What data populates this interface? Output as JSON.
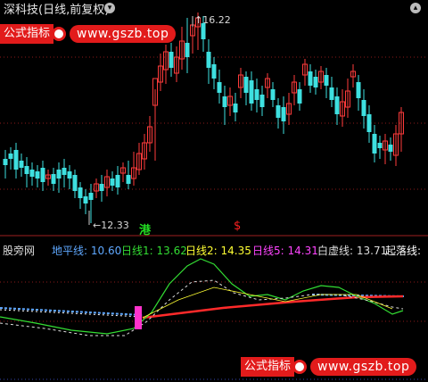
{
  "header": {
    "title": "深科技(日线,前复权)",
    "menu_icon": "chevron-down-icon",
    "corner_icon": "chevron-up-icon"
  },
  "watermark_top": {
    "label": "公式指标",
    "url": "www.gszb.top"
  },
  "watermark_bottom": {
    "label": "公式指标",
    "url": "www.gszb.top"
  },
  "price_marks": {
    "high": "16.22",
    "low": "12.33"
  },
  "signals": {
    "gang": "港",
    "s": "$"
  },
  "indicator": {
    "name": "股旁网",
    "items": [
      {
        "label": "地平线: 10.60",
        "color": "#5fa8ff"
      },
      {
        "label": "日线1: 13.62",
        "color": "#33dd33"
      },
      {
        "label": "日线2: 14.35",
        "color": "#ffff33"
      },
      {
        "label": "日线5: 14.31",
        "color": "#ff44ff"
      },
      {
        "label": "白虚线: 13.71",
        "color": "#dddddd"
      },
      {
        "label": "起落线:",
        "color": "#ffffff"
      }
    ]
  },
  "colors": {
    "up": "#ff3b3b",
    "down": "#3ee0e0",
    "grid": "#8b1a1a",
    "bg": "#000000"
  }
}
